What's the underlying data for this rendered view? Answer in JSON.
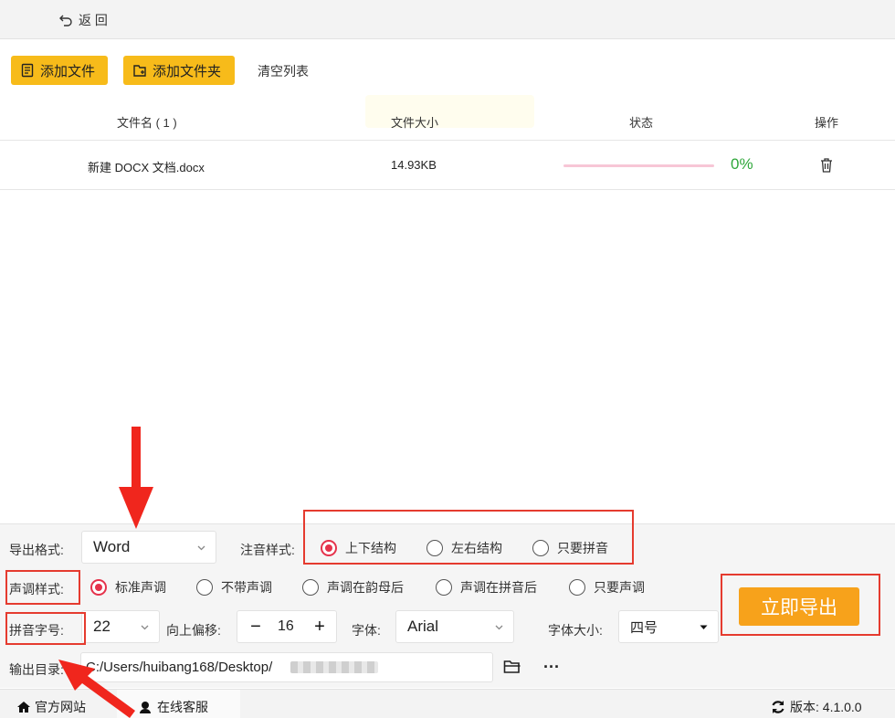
{
  "topbar": {
    "back_label": "返 回"
  },
  "toolbar": {
    "add_file": "添加文件",
    "add_folder": "添加文件夹",
    "clear_list": "清空列表"
  },
  "table": {
    "headers": {
      "name": "文件名 ( 1 )",
      "size": "文件大小",
      "status": "状态",
      "action": "操作"
    },
    "rows": [
      {
        "name": "新建 DOCX 文档.docx",
        "size": "14.93KB",
        "progress": "0%"
      }
    ]
  },
  "settings": {
    "export_format_label": "导出格式:",
    "export_format_value": "Word",
    "annotation_style_label": "注音样式:",
    "annotation_options": [
      "上下结构",
      "左右结构",
      "只要拼音"
    ],
    "tone_style_label": "声调样式:",
    "tone_options": [
      "标准声调",
      "不带声调",
      "声调在韵母后",
      "声调在拼音后",
      "只要声调"
    ],
    "pinyin_size_label": "拼音字号:",
    "pinyin_size_value": "22",
    "offset_label": "向上偏移:",
    "offset_value": "16",
    "font_label": "字体:",
    "font_value": "Arial",
    "font_size_label": "字体大小:",
    "font_size_value": "四号",
    "output_dir_label": "输出目录:",
    "output_dir_value": "C:/Users/huibang168/Desktop/",
    "more_label": "···",
    "export_button": "立即导出"
  },
  "bottombar": {
    "website": "官方网站",
    "support": "在线客服",
    "version": "版本:  4.1.0.0"
  },
  "colors": {
    "accent_yellow": "#f7bb1a",
    "export_orange": "#f7a21b",
    "radio_red": "#e5324b",
    "progress_green": "#2fa73b",
    "annotation_red": "#e53b2f"
  }
}
